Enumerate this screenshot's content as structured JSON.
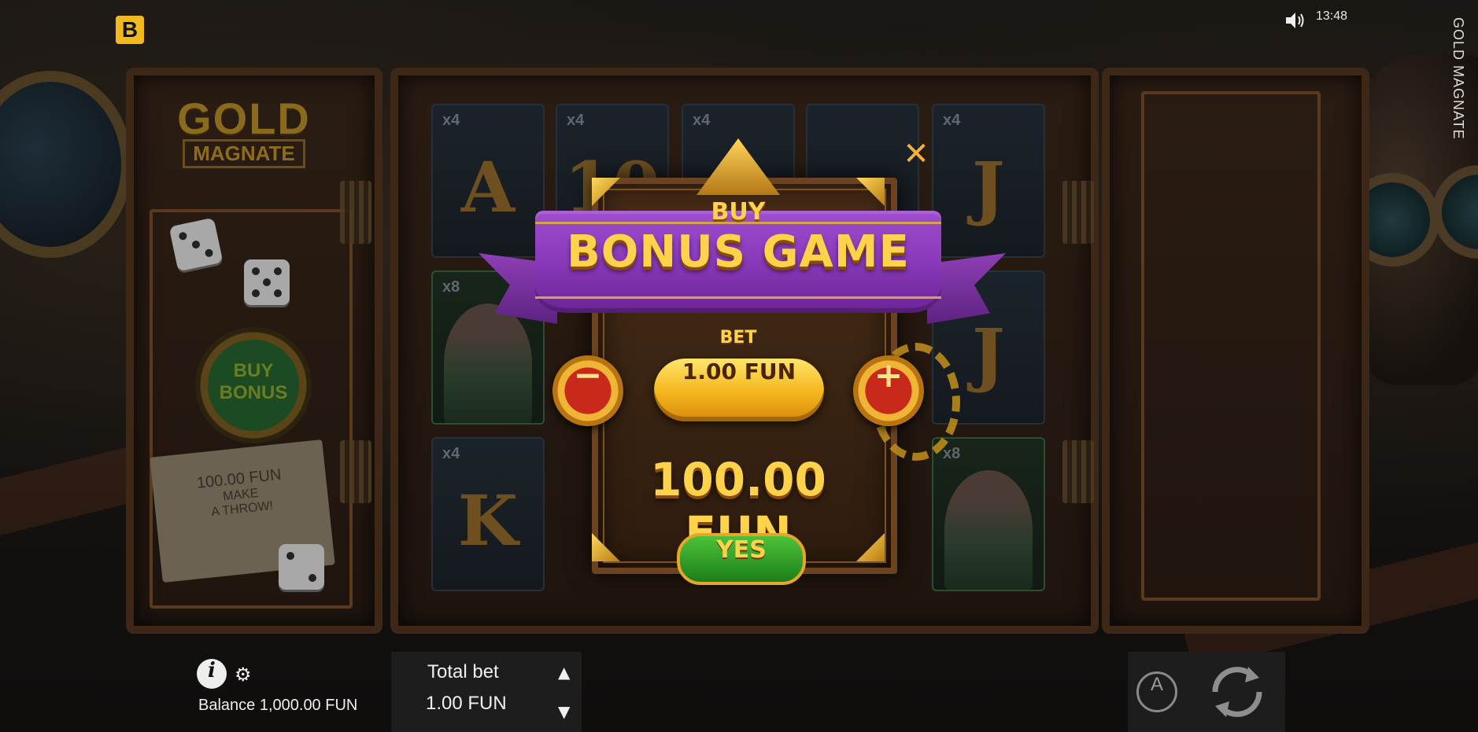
{
  "brand": {
    "logo_text": "B"
  },
  "status": {
    "time": "13:48"
  },
  "game": {
    "vertical_title": "GOLD MAGNATE",
    "logo_line1": "GOLD",
    "logo_line2": "MAGNATE"
  },
  "side_panel": {
    "buy_bonus_line1": "BUY",
    "buy_bonus_line2": "BONUS",
    "note_amount": "100.00 FUN",
    "note_line2": "MAKE",
    "note_line3": "A THROW!"
  },
  "reels": [
    {
      "mult": "x4",
      "symbol": "A"
    },
    {
      "mult": "x4",
      "symbol": "10"
    },
    {
      "mult": "x4",
      "symbol": ""
    },
    {
      "mult": "",
      "symbol": ""
    },
    {
      "mult": "x4",
      "symbol": "J"
    },
    {
      "mult": "x8",
      "symbol": ""
    },
    {
      "mult": "",
      "symbol": "J"
    },
    {
      "mult": "x4",
      "symbol": "K"
    },
    {
      "mult": "x8",
      "symbol": ""
    }
  ],
  "dialog": {
    "title_small": "BUY",
    "title_main": "BONUS GAME",
    "bet_label": "BET",
    "bet_value": "1.00 FUN",
    "price": "100.00 FUN",
    "confirm_label": "YES",
    "minus_label": "−",
    "plus_label": "+",
    "close_label": "✕"
  },
  "bottom_bar": {
    "info_label": "i",
    "balance": "Balance 1,000.00 FUN",
    "total_bet_label": "Total bet",
    "total_bet_value": "1.00 FUN",
    "autoplay_label": "A"
  },
  "colors": {
    "gold": "#ffd24c",
    "ribbon_purple": "#8637b6",
    "yes_green": "#2fa02a",
    "brand_yellow": "#f2b91e"
  },
  "icons": {
    "sound": "speaker-icon",
    "info": "info-icon",
    "settings": "gear-icon",
    "autoplay": "autoplay-icon",
    "spin": "spin-icon",
    "bet_up": "arrow-up-icon",
    "bet_down": "arrow-down-icon"
  }
}
